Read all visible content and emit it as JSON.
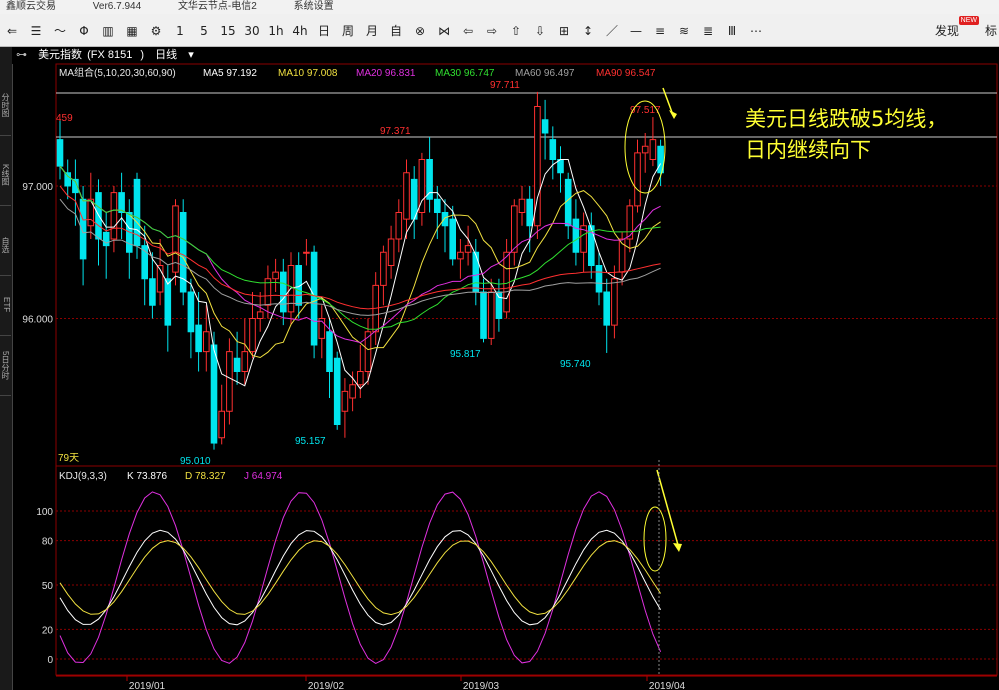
{
  "titlebar": {
    "app": "鑫顺云交易",
    "version": "Ver6.7.944",
    "server": "文华云节点-电信2",
    "menu": "系统设置"
  },
  "toolbar": {
    "items": [
      "⇐",
      "☰",
      "〜",
      "Φ",
      "▥",
      "▦",
      "⚙",
      "1",
      "5",
      "15",
      "30",
      "1h",
      "4h",
      "日",
      "周",
      "月",
      "自",
      "⊗",
      "⋈",
      "⇦",
      "⇨",
      "⇧",
      "⇩",
      "⊞",
      "↕",
      "／",
      "—",
      "≡",
      "≋",
      "≣",
      "Ⅲ",
      "⋯"
    ],
    "discover_label": "发现",
    "new_badge": "NEW",
    "cut_label": "标"
  },
  "sidebar": {
    "tabs": [
      "分时图",
      "K线图",
      "自选",
      "ETF",
      "5日分时"
    ]
  },
  "symbol": {
    "name": "美元指数",
    "code": "FX 8151",
    "period": "日线"
  },
  "price_panel": {
    "ma_label": "MA组合(5,10,20,30,60,90)",
    "ma_values": [
      {
        "name": "MA5",
        "value": "97.192",
        "color": "#ffffff"
      },
      {
        "name": "MA10",
        "value": "97.008",
        "color": "#f0e040"
      },
      {
        "name": "MA20",
        "value": "96.831",
        "color": "#e030e0"
      },
      {
        "name": "MA30",
        "value": "96.747",
        "color": "#30e030"
      },
      {
        "name": "MA60",
        "value": "96.497",
        "color": "#a0a0a0"
      },
      {
        "name": "MA90",
        "value": "96.547",
        "color": "#ff3030"
      }
    ],
    "ticks": [
      "97.000",
      "96.000"
    ],
    "labels": [
      "459",
      "97.711",
      "97.371",
      "97.517",
      "95.817",
      "95.740",
      "95.157",
      "95.010"
    ],
    "days_label": "79天",
    "annotation_line1": "美元日线跌破5均线，",
    "annotation_line2": "日内继续向下"
  },
  "kdj_panel": {
    "label": "KDJ(9,3,3)",
    "K": "K 73.876",
    "D": "D 78.327",
    "J": "J 64.974",
    "ticks": [
      "100",
      "80",
      "50",
      "20",
      "0"
    ]
  },
  "date_axis": [
    "2019/01",
    "2019/02",
    "2019/03",
    "2019/04"
  ],
  "colors": {
    "up": "#ff3030",
    "down": "#00e5ee",
    "grid": "#8b0000",
    "annotation": "#ffff33"
  }
}
